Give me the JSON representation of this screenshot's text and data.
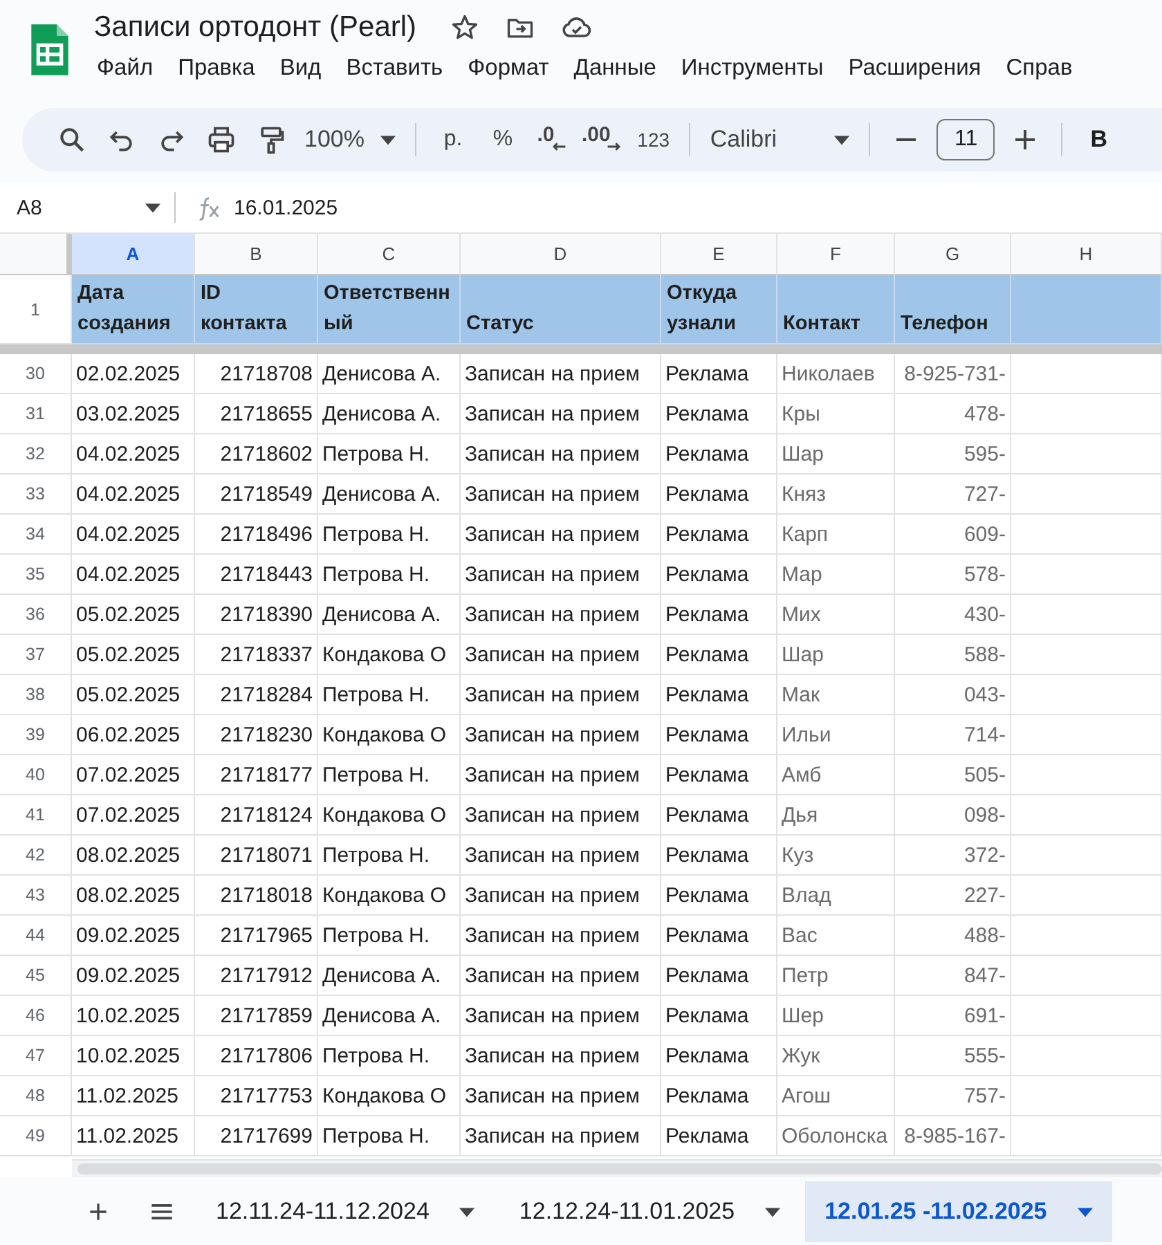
{
  "document": {
    "title": "Записи ортодонт (Pearl)"
  },
  "menu": [
    "Файл",
    "Правка",
    "Вид",
    "Вставить",
    "Формат",
    "Данные",
    "Инструменты",
    "Расширения",
    "Справ"
  ],
  "toolbar": {
    "zoom": "100%",
    "currency": "р.",
    "percent": "%",
    "decrease_decimals": ".0",
    "increase_decimals": ".00",
    "number_format": "123",
    "font": "Calibri",
    "font_size": "11",
    "bold": "B"
  },
  "formula_bar": {
    "cell": "A8",
    "value": "16.01.2025"
  },
  "columns": [
    {
      "label": "A",
      "selected": true
    },
    {
      "label": "B",
      "selected": false
    },
    {
      "label": "C",
      "selected": false
    },
    {
      "label": "D",
      "selected": false
    },
    {
      "label": "E",
      "selected": false
    },
    {
      "label": "F",
      "selected": false
    },
    {
      "label": "G",
      "selected": false
    },
    {
      "label": "H",
      "selected": false
    }
  ],
  "header_row": {
    "number": "1",
    "cells": [
      "Дата создания",
      "ID контакта",
      "Ответственный",
      "Статус",
      "Откуда узнали",
      "Контакт",
      "Телефон"
    ]
  },
  "rows": [
    {
      "number": "30",
      "date": "02.02.2025",
      "id": "21718708",
      "owner": "Денисова А.",
      "status": "Записан на прием",
      "source": "Реклама",
      "contact": "Николаев",
      "phone": "8-925-731-"
    },
    {
      "number": "31",
      "date": "03.02.2025",
      "id": "21718655",
      "owner": "Денисова А.",
      "status": "Записан на прием",
      "source": "Реклама",
      "contact": "Кры",
      "phone": "478-"
    },
    {
      "number": "32",
      "date": "04.02.2025",
      "id": "21718602",
      "owner": "Петрова Н.",
      "status": "Записан на прием",
      "source": "Реклама",
      "contact": "Шар",
      "phone": "595-"
    },
    {
      "number": "33",
      "date": "04.02.2025",
      "id": "21718549",
      "owner": "Денисова А.",
      "status": "Записан на прием",
      "source": "Реклама",
      "contact": "Княз",
      "phone": "727-"
    },
    {
      "number": "34",
      "date": "04.02.2025",
      "id": "21718496",
      "owner": "Петрова Н.",
      "status": "Записан на прием",
      "source": "Реклама",
      "contact": "Карп",
      "phone": "609-"
    },
    {
      "number": "35",
      "date": "04.02.2025",
      "id": "21718443",
      "owner": "Петрова Н.",
      "status": "Записан на прием",
      "source": "Реклама",
      "contact": "Мар",
      "phone": "578-"
    },
    {
      "number": "36",
      "date": "05.02.2025",
      "id": "21718390",
      "owner": "Денисова А.",
      "status": "Записан на прием",
      "source": "Реклама",
      "contact": "Мих",
      "phone": "430-"
    },
    {
      "number": "37",
      "date": "05.02.2025",
      "id": "21718337",
      "owner": "Кондакова О",
      "status": "Записан на прием",
      "source": "Реклама",
      "contact": "Шар",
      "phone": "588-"
    },
    {
      "number": "38",
      "date": "05.02.2025",
      "id": "21718284",
      "owner": "Петрова Н.",
      "status": "Записан на прием",
      "source": "Реклама",
      "contact": "Мак",
      "phone": "043-"
    },
    {
      "number": "39",
      "date": "06.02.2025",
      "id": "21718230",
      "owner": "Кондакова О",
      "status": "Записан на прием",
      "source": "Реклама",
      "contact": "Ильи",
      "phone": "714-"
    },
    {
      "number": "40",
      "date": "07.02.2025",
      "id": "21718177",
      "owner": "Петрова Н.",
      "status": "Записан на прием",
      "source": "Реклама",
      "contact": "Амб",
      "phone": "505-"
    },
    {
      "number": "41",
      "date": "07.02.2025",
      "id": "21718124",
      "owner": "Кондакова О",
      "status": "Записан на прием",
      "source": "Реклама",
      "contact": "Дья",
      "phone": "098-"
    },
    {
      "number": "42",
      "date": "08.02.2025",
      "id": "21718071",
      "owner": "Петрова Н.",
      "status": "Записан на прием",
      "source": "Реклама",
      "contact": "Куз",
      "phone": "372-"
    },
    {
      "number": "43",
      "date": "08.02.2025",
      "id": "21718018",
      "owner": "Кондакова О",
      "status": "Записан на прием",
      "source": "Реклама",
      "contact": "Влад",
      "phone": "227-"
    },
    {
      "number": "44",
      "date": "09.02.2025",
      "id": "21717965",
      "owner": "Петрова Н.",
      "status": "Записан на прием",
      "source": "Реклама",
      "contact": "Вас",
      "phone": "488-"
    },
    {
      "number": "45",
      "date": "09.02.2025",
      "id": "21717912",
      "owner": "Денисова А.",
      "status": "Записан на прием",
      "source": "Реклама",
      "contact": "Петр",
      "phone": "847-"
    },
    {
      "number": "46",
      "date": "10.02.2025",
      "id": "21717859",
      "owner": "Денисова А.",
      "status": "Записан на прием",
      "source": "Реклама",
      "contact": "Шер",
      "phone": "691-"
    },
    {
      "number": "47",
      "date": "10.02.2025",
      "id": "21717806",
      "owner": "Петрова Н.",
      "status": "Записан на прием",
      "source": "Реклама",
      "contact": "Жук",
      "phone": "555-"
    },
    {
      "number": "48",
      "date": "11.02.2025",
      "id": "21717753",
      "owner": "Кондакова О",
      "status": "Записан на прием",
      "source": "Реклама",
      "contact": "Агош",
      "phone": "757-"
    },
    {
      "number": "49",
      "date": "11.02.2025",
      "id": "21717699",
      "owner": "Петрова Н.",
      "status": "Записан на прием",
      "source": "Реклама",
      "contact": "Оболонска",
      "phone": "8-985-167-"
    }
  ],
  "sheet_tabs": [
    {
      "label": "12.11.24-11.12.2024",
      "selected": false
    },
    {
      "label": "12.12.24-11.01.2025",
      "selected": false
    },
    {
      "label": "12.01.25 -11.02.2025",
      "selected": true
    }
  ]
}
